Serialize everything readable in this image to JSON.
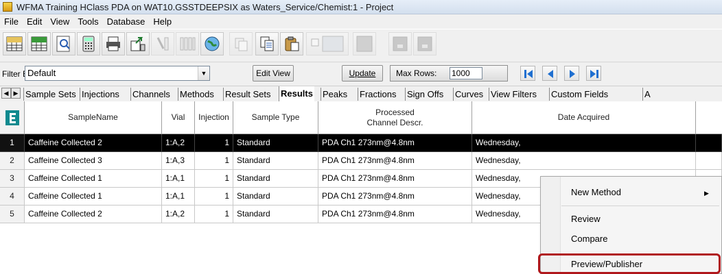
{
  "window": {
    "title": "WFMA Training HClass PDA on WAT10.GSSTDEEPSIX as Waters_Service/Chemist:1 - Project"
  },
  "menu": [
    "File",
    "Edit",
    "View",
    "Tools",
    "Database",
    "Help"
  ],
  "filter": {
    "label": "Filter By:",
    "value": "Default",
    "edit_view_label": "Edit View",
    "update_label": "Update",
    "max_rows_label": "Max Rows:",
    "max_rows_value": "1000"
  },
  "tabs": [
    {
      "label": "Sample Sets"
    },
    {
      "label": "Injections"
    },
    {
      "label": "Channels"
    },
    {
      "label": "Methods"
    },
    {
      "label": "Result Sets"
    },
    {
      "label": "Results",
      "active": true
    },
    {
      "label": "Peaks"
    },
    {
      "label": "Fractions"
    },
    {
      "label": "Sign Offs"
    },
    {
      "label": "Curves"
    },
    {
      "label": "View Filters"
    },
    {
      "label": "Custom Fields"
    },
    {
      "label": "A"
    }
  ],
  "grid": {
    "headers": {
      "sample_name": "SampleName",
      "vial": "Vial",
      "injection": "Injection",
      "sample_type": "Sample Type",
      "channel_line1": "Processed",
      "channel_line2": "Channel Descr.",
      "date_acquired": "Date Acquired"
    },
    "rows": [
      {
        "num": "1",
        "sample_name": "Caffeine Collected 2",
        "vial": "1:A,2",
        "injection": "1",
        "sample_type": "Standard",
        "channel": "PDA Ch1 273nm@4.8nm",
        "date": "Wednesday,",
        "selected": true
      },
      {
        "num": "2",
        "sample_name": "Caffeine Collected 3",
        "vial": "1:A,3",
        "injection": "1",
        "sample_type": "Standard",
        "channel": "PDA Ch1 273nm@4.8nm",
        "date": "Wednesday,"
      },
      {
        "num": "3",
        "sample_name": "Caffeine Collected 1",
        "vial": "1:A,1",
        "injection": "1",
        "sample_type": "Standard",
        "channel": "PDA Ch1 273nm@4.8nm",
        "date": "Wednesday,"
      },
      {
        "num": "4",
        "sample_name": "Caffeine Collected 1",
        "vial": "1:A,1",
        "injection": "1",
        "sample_type": "Standard",
        "channel": "PDA Ch1 273nm@4.8nm",
        "date": "Wednesday,"
      },
      {
        "num": "5",
        "sample_name": "Caffeine Collected 2",
        "vial": "1:A,2",
        "injection": "1",
        "sample_type": "Standard",
        "channel": "PDA Ch1 273nm@4.8nm",
        "date": "Wednesday,"
      }
    ]
  },
  "context_menu": {
    "items": [
      {
        "label": "New Method",
        "submenu": true
      },
      {
        "label": "Review"
      },
      {
        "label": "Compare"
      },
      {
        "label": "Preview/Publisher",
        "highlighted": true
      }
    ]
  },
  "colors": {
    "highlight_border": "#b0171b",
    "selected_row_bg": "#000000"
  }
}
